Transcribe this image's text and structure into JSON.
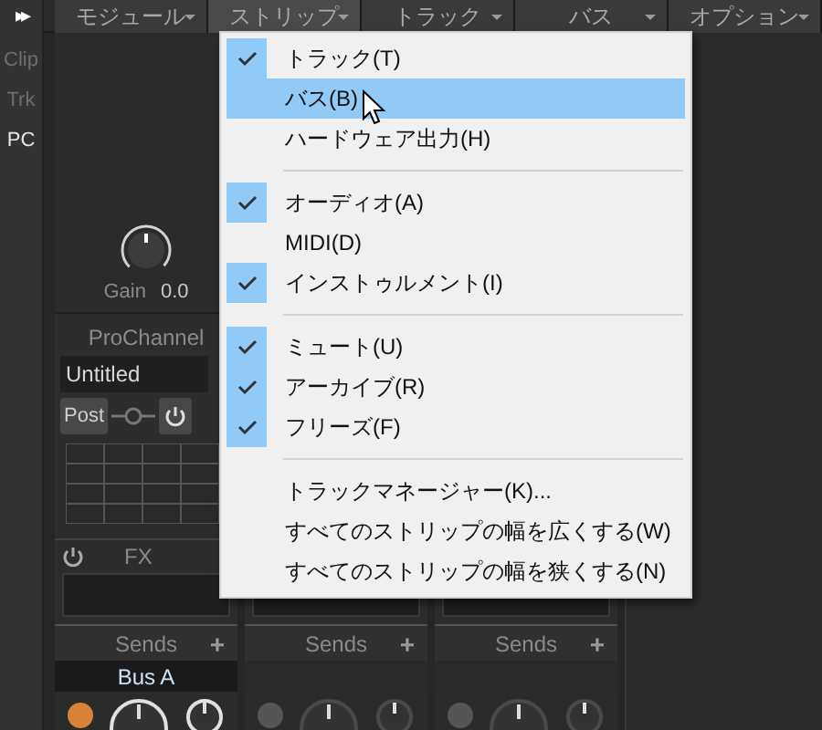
{
  "sidebar": {
    "expand_glyph": "▸▸",
    "items": [
      {
        "label": "Clip",
        "selected": false
      },
      {
        "label": "Trk",
        "selected": false
      },
      {
        "label": "PC",
        "selected": true
      }
    ]
  },
  "menu_bar": [
    {
      "label": "モジュール",
      "open": false
    },
    {
      "label": "ストリップ",
      "open": true
    },
    {
      "label": "トラック",
      "open": false
    },
    {
      "label": "バス",
      "open": false
    },
    {
      "label": "オプション",
      "open": false
    }
  ],
  "dropdown": [
    {
      "kind": "item",
      "label": "トラック(T)",
      "checked": true,
      "selected": false
    },
    {
      "kind": "item",
      "label": "バス(B)",
      "checked": false,
      "selected": true
    },
    {
      "kind": "item",
      "label": "ハードウェア出力(H)",
      "checked": false,
      "selected": false
    },
    {
      "kind": "separator"
    },
    {
      "kind": "item",
      "label": "オーディオ(A)",
      "checked": true,
      "selected": false
    },
    {
      "kind": "item",
      "label": "MIDI(D)",
      "checked": false,
      "selected": false
    },
    {
      "kind": "item",
      "label": "インストゥルメント(I)",
      "checked": true,
      "selected": false
    },
    {
      "kind": "separator"
    },
    {
      "kind": "item",
      "label": "ミュート(U)",
      "checked": true,
      "selected": false
    },
    {
      "kind": "item",
      "label": "アーカイブ(R)",
      "checked": true,
      "selected": false
    },
    {
      "kind": "item",
      "label": "フリーズ(F)",
      "checked": true,
      "selected": false
    },
    {
      "kind": "separator"
    },
    {
      "kind": "item",
      "label": "トラックマネージャー(K)...",
      "checked": false,
      "selected": false
    },
    {
      "kind": "item",
      "label": "すべてのストリップの幅を広くする(W)",
      "checked": false,
      "selected": false
    },
    {
      "kind": "item",
      "label": "すべてのストリップの幅を狭くする(N)",
      "checked": false,
      "selected": false
    }
  ],
  "strips": [
    {
      "gain_label": "Gain",
      "gain_value": "0.0",
      "prochannel": "ProChannel",
      "preset": "Untitled",
      "post_button": "Post",
      "fx_label": "FX",
      "sends_label": "Sends",
      "add_glyph": "+",
      "send_bus": "Bus A",
      "send_on": true
    },
    {
      "sends_label": "Sends",
      "add_glyph": "+",
      "send_on": false
    },
    {
      "sends_label": "Sends",
      "add_glyph": "+",
      "send_on": false
    }
  ]
}
